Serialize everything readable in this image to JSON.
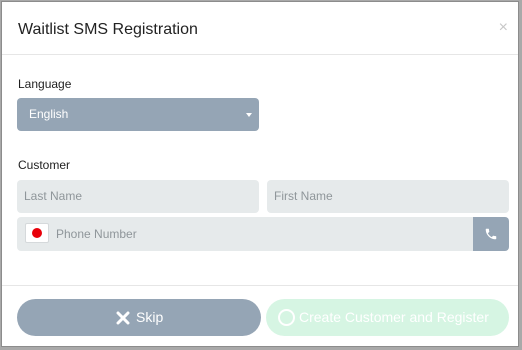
{
  "modal": {
    "title": "Waitlist SMS Registration",
    "close_icon": "×"
  },
  "language": {
    "label": "Language",
    "selected": "English"
  },
  "customer": {
    "label": "Customer",
    "last_name_placeholder": "Last Name",
    "first_name_placeholder": "First Name",
    "phone_placeholder": "Phone Number",
    "flag_icon": "japan-flag-icon",
    "phone_button_icon": "phone-icon"
  },
  "footer": {
    "skip_label": "Skip",
    "skip_icon": "x-icon",
    "create_label": "Create Customer and Register",
    "create_icon": "circle-icon"
  },
  "colors": {
    "slate": "#95a5b5",
    "input_bg": "#e6eaeb",
    "create_bg": "#d6f5e3",
    "flag_red": "#e8000a"
  }
}
